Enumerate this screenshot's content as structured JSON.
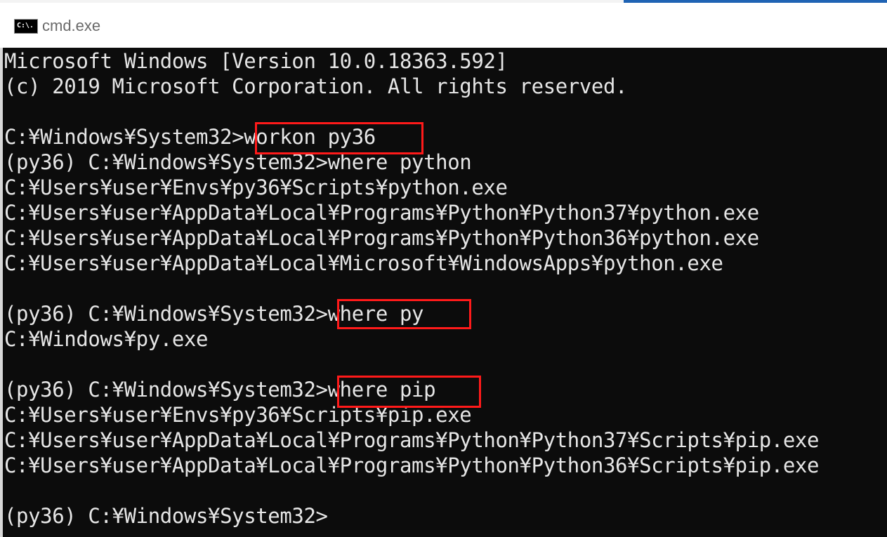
{
  "window": {
    "title": "cmd.exe",
    "icon_text": "C:\\."
  },
  "colors": {
    "console_bg": "#0c0c0c",
    "console_fg": "#e6e6e6",
    "highlight": "#ff1a1a",
    "accent": "#1f63b4"
  },
  "console": {
    "lines": [
      "Microsoft Windows [Version 10.0.18363.592]",
      "(c) 2019 Microsoft Corporation. All rights reserved.",
      "",
      "C:¥Windows¥System32>workon py36",
      "(py36) C:¥Windows¥System32>where python",
      "C:¥Users¥user¥Envs¥py36¥Scripts¥python.exe",
      "C:¥Users¥user¥AppData¥Local¥Programs¥Python¥Python37¥python.exe",
      "C:¥Users¥user¥AppData¥Local¥Programs¥Python¥Python36¥python.exe",
      "C:¥Users¥user¥AppData¥Local¥Microsoft¥WindowsApps¥python.exe",
      "",
      "(py36) C:¥Windows¥System32>where py",
      "C:¥Windows¥py.exe",
      "",
      "(py36) C:¥Windows¥System32>where pip",
      "C:¥Users¥user¥Envs¥py36¥Scripts¥pip.exe",
      "C:¥Users¥user¥AppData¥Local¥Programs¥Python¥Python37¥Scripts¥pip.exe",
      "C:¥Users¥user¥AppData¥Local¥Programs¥Python¥Python36¥Scripts¥pip.exe",
      "",
      "(py36) C:¥Windows¥System32>"
    ]
  }
}
